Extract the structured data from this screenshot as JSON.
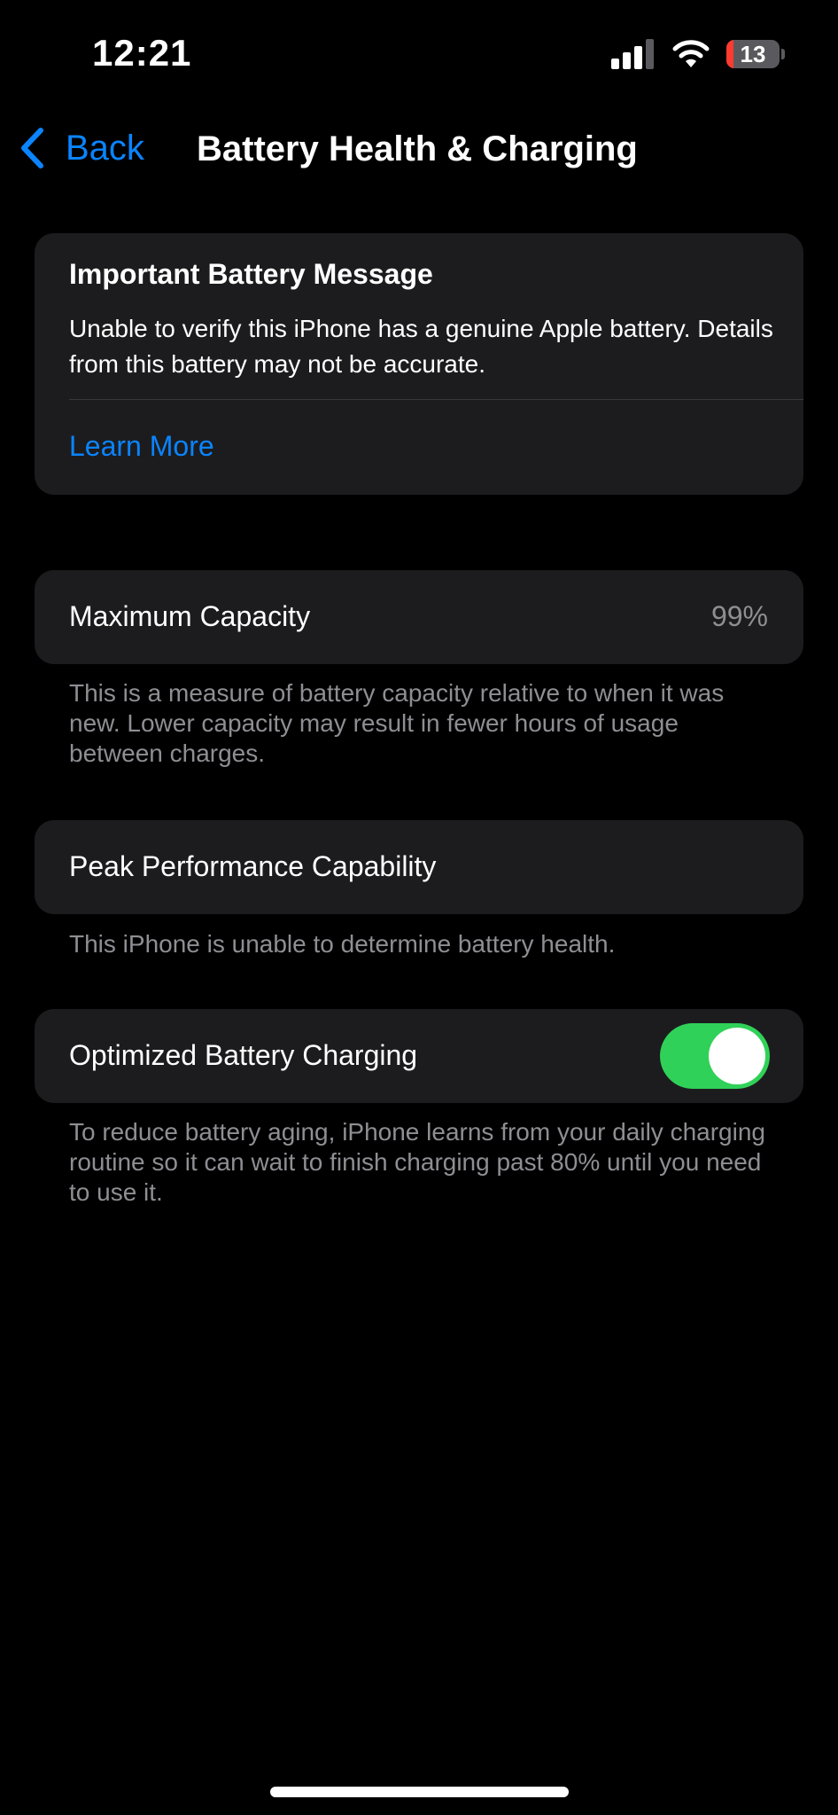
{
  "status_bar": {
    "time": "12:21",
    "battery_level": "13",
    "battery_fill_fraction": 0.13,
    "battery_color": "#ff3b30",
    "icons": [
      "cellular-signal-icon",
      "wifi-icon",
      "battery-icon"
    ]
  },
  "nav": {
    "back_icon": "chevron-left-icon",
    "back_label": "Back",
    "title": "Battery Health & Charging"
  },
  "battery_message": {
    "title": "Important Battery Message",
    "body": "Unable to verify this iPhone has a genuine Apple battery. Details from this battery may not be accurate.",
    "learn_more": "Learn More"
  },
  "maximum_capacity": {
    "label": "Maximum Capacity",
    "value": "99%",
    "footnote": "This is a measure of battery capacity relative to when it was new. Lower capacity may result in fewer hours of usage between charges."
  },
  "peak_performance": {
    "label": "Peak Performance Capability",
    "footnote": "This iPhone is unable to determine battery health."
  },
  "optimized_charging": {
    "label": "Optimized Battery Charging",
    "enabled": true,
    "footnote": "To reduce battery aging, iPhone learns from your daily charging routine so it can wait to finish charging past 80% until you need to use it."
  },
  "colors": {
    "accent": "#0a84ff",
    "toggle_on": "#30d158",
    "card_background": "#1c1c1e",
    "secondary_text": "#8e8e93"
  }
}
